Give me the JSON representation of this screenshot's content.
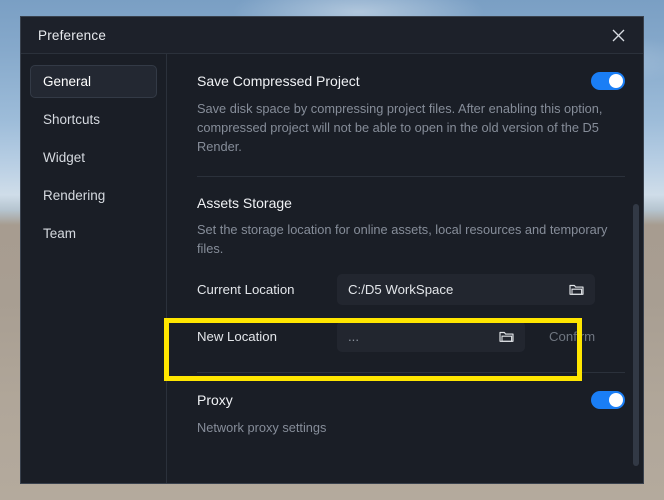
{
  "dialog": {
    "title": "Preference",
    "close_icon": "close-icon"
  },
  "sidebar": {
    "items": [
      {
        "label": "General"
      },
      {
        "label": "Shortcuts"
      },
      {
        "label": "Widget"
      },
      {
        "label": "Rendering"
      },
      {
        "label": "Team"
      }
    ]
  },
  "sections": {
    "compressed": {
      "title": "Save Compressed Project",
      "description": "Save disk space by compressing project files.\nAfter enabling this option, compressed project will not be able to open in the old version of the D5 Render.",
      "toggle_state": "on"
    },
    "assets": {
      "title": "Assets Storage",
      "description": "Set the storage location for online assets, local resources and temporary files.",
      "current_location_label": "Current Location",
      "current_location_value": "C:/D5 WorkSpace",
      "new_location_label": "New Location",
      "new_location_value": "...",
      "confirm_label": "Confirm",
      "folder_icon": "folder-icon"
    },
    "proxy": {
      "title": "Proxy",
      "description": "Network proxy settings",
      "toggle_state": "on"
    }
  },
  "colors": {
    "accent": "#1a7ef5",
    "highlight": "#ffe600",
    "panel": "#1a1e26",
    "field": "#22262f"
  }
}
